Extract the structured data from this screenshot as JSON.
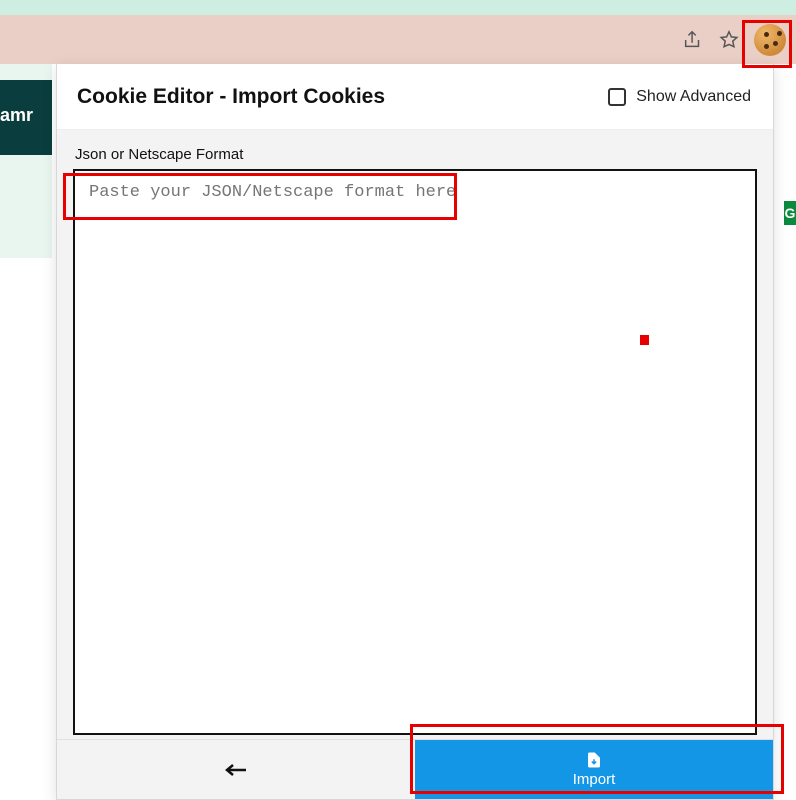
{
  "browser_toolbar": {
    "share_icon": "share-icon",
    "star_icon": "star-icon",
    "cookie_extension_icon": "cookie-extension-icon"
  },
  "background": {
    "partial_word": "amr",
    "green_badge": "G"
  },
  "popup": {
    "title": "Cookie Editor - Import Cookies",
    "show_advanced_label": "Show Advanced",
    "show_advanced_checked": false,
    "field_label": "Json or Netscape Format",
    "textarea_placeholder": "Paste your JSON/Netscape format here",
    "textarea_value": "",
    "footer": {
      "back_label": "Back",
      "import_label": "Import"
    }
  }
}
